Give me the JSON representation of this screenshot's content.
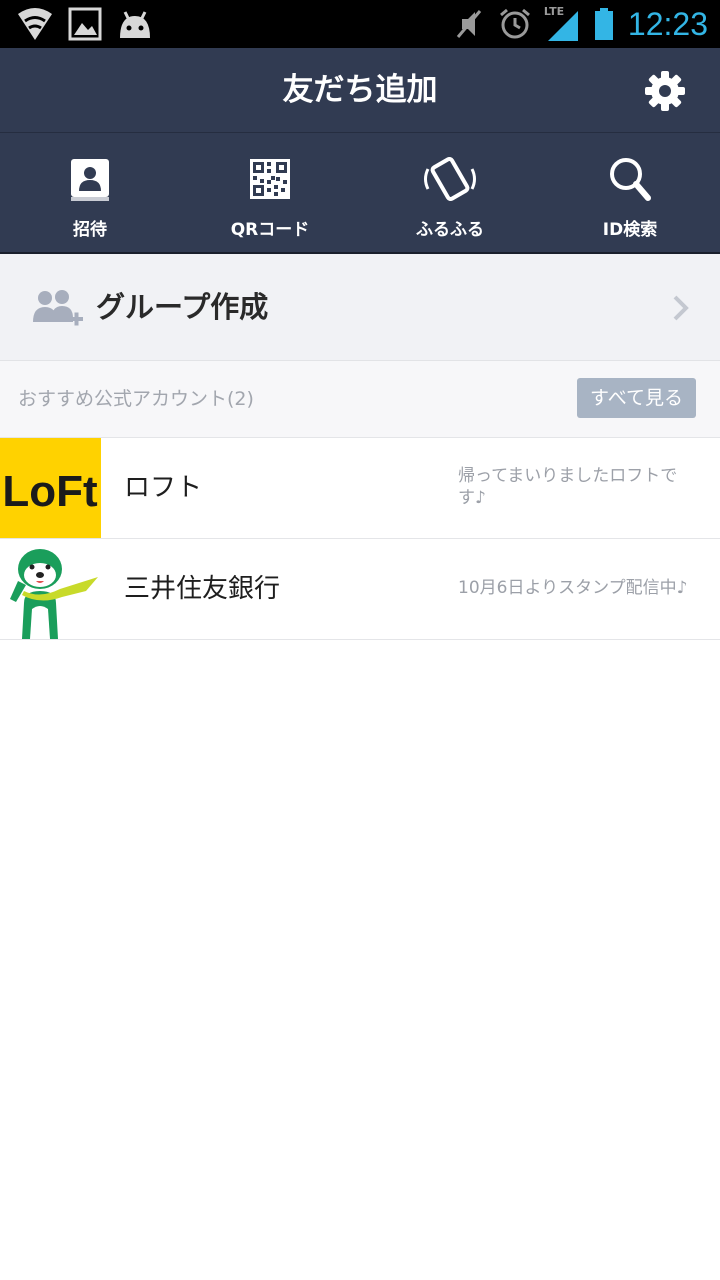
{
  "status_bar": {
    "time": "12:23",
    "network": "LTE",
    "icons": [
      "wifi-icon",
      "image-icon",
      "android-icon",
      "mute-icon",
      "alarm-icon",
      "signal-icon",
      "battery-icon"
    ]
  },
  "header": {
    "title": "友だち追加",
    "settings_icon": "gear-icon"
  },
  "toolbar": {
    "items": [
      {
        "label": "招待",
        "icon": "contact-book-icon"
      },
      {
        "label": "QRコード",
        "icon": "qr-code-icon"
      },
      {
        "label": "ふるふる",
        "icon": "shake-phone-icon"
      },
      {
        "label": "ID検索",
        "icon": "search-icon"
      }
    ]
  },
  "group_create": {
    "label": "グループ作成",
    "icon": "add-group-icon"
  },
  "recommended": {
    "title": "おすすめ公式アカウント(2)",
    "see_all_label": "すべて見る",
    "accounts": [
      {
        "name": "ロフト",
        "message": "帰ってまいりましたロフトです♪",
        "logo_text": "LoFt",
        "logo_bg": "#ffd200"
      },
      {
        "name": "三井住友銀行",
        "message": "10月6日よりスタンプ配信中♪",
        "mascot": "green-mascot-image"
      }
    ]
  },
  "colors": {
    "header_bg": "#313b52",
    "clock": "#33b5e5",
    "button_bg": "#a8b4c4"
  }
}
